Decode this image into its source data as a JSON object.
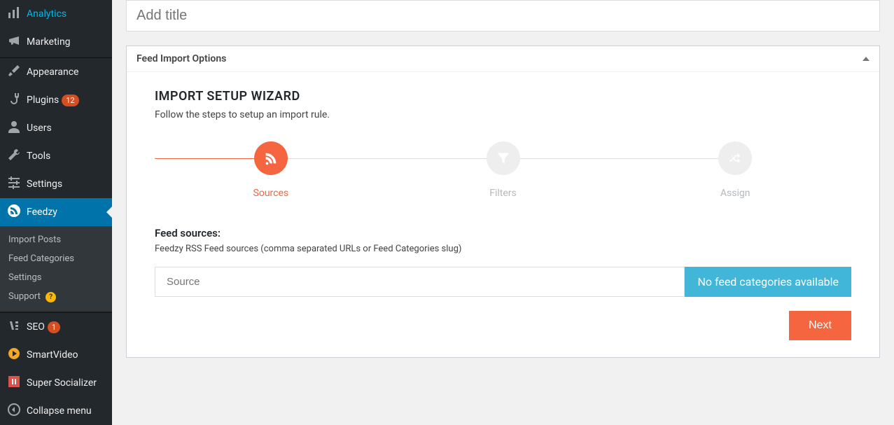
{
  "sidebar": {
    "items": [
      {
        "label": "Analytics",
        "icon": "bars"
      },
      {
        "label": "Marketing",
        "icon": "megaphone"
      },
      {
        "label": "Appearance",
        "icon": "brush",
        "sep": true
      },
      {
        "label": "Plugins",
        "icon": "plug",
        "badge": "12"
      },
      {
        "label": "Users",
        "icon": "user"
      },
      {
        "label": "Tools",
        "icon": "wrench"
      },
      {
        "label": "Settings",
        "icon": "sliders"
      },
      {
        "label": "Feedzy",
        "icon": "feedzy",
        "active": true
      },
      {
        "label": "SEO",
        "icon": "seo",
        "badge": "1",
        "sep2": true
      },
      {
        "label": "SmartVideo",
        "icon": "smartvideo"
      },
      {
        "label": "Super Socializer",
        "icon": "socializer"
      },
      {
        "label": "Collapse menu",
        "icon": "collapse",
        "collapse": true
      }
    ],
    "submenu": [
      {
        "label": "Import Posts"
      },
      {
        "label": "Feed Categories"
      },
      {
        "label": "Settings"
      },
      {
        "label": "Support",
        "help": "?"
      }
    ]
  },
  "title_placeholder": "Add title",
  "panel_title": "Feed Import Options",
  "wizard": {
    "title": "IMPORT SETUP WIZARD",
    "subtitle": "Follow the steps to setup an import rule.",
    "steps": [
      {
        "label": "Sources",
        "icon": "rss",
        "active": true
      },
      {
        "label": "Filters",
        "icon": "funnel"
      },
      {
        "label": "Assign",
        "icon": "shuffle"
      }
    ]
  },
  "feed": {
    "title": "Feed sources:",
    "subtitle": "Feedzy RSS Feed sources (comma separated URLs or Feed Categories slug)",
    "placeholder": "Source",
    "no_categories": "No feed categories available"
  },
  "next_label": "Next"
}
